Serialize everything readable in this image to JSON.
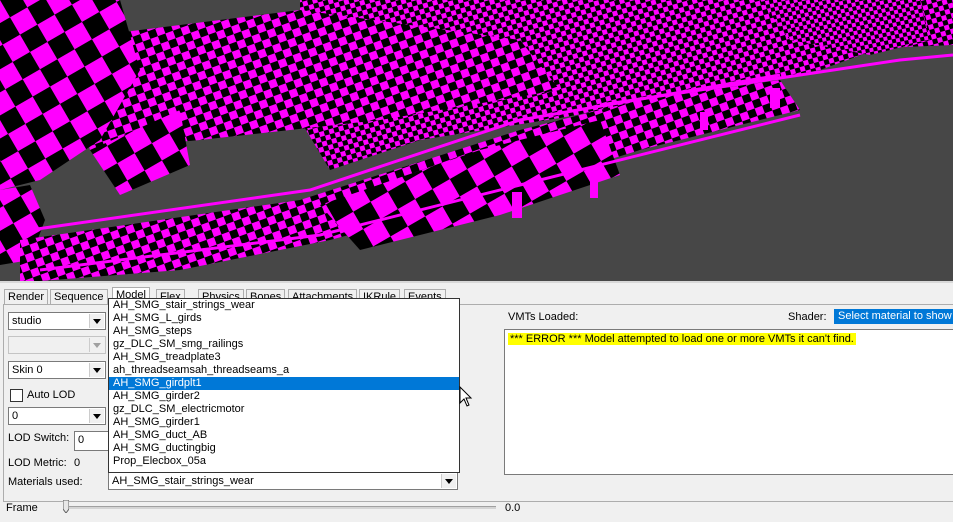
{
  "tabs": [
    {
      "label": "Render"
    },
    {
      "label": "Sequence"
    },
    {
      "label": "Model"
    },
    {
      "label": "Flex"
    },
    {
      "label": "Physics"
    },
    {
      "label": "Bones"
    },
    {
      "label": "Attachments"
    },
    {
      "label": "IKRule"
    },
    {
      "label": "Events"
    }
  ],
  "active_tab": "Model",
  "left": {
    "bodygroup_value": "studio",
    "submodel_value": "",
    "skin_value": "Skin 0",
    "auto_lod_label": "Auto LOD",
    "lod_value": "0",
    "lod_switch_label": "LOD Switch:",
    "lod_switch_value": "0",
    "lod_metric_label": "LOD Metric:",
    "lod_metric_value": "0",
    "materials_label": "Materials used:",
    "materials_value": "AH_SMG_stair_strings_wear"
  },
  "materials_list": [
    "AH_SMG_stair_strings_wear",
    "AH_SMG_L_girds",
    "AH_SMG_steps",
    "gz_DLC_SM_smg_railings",
    "AH_SMG_treadplate3",
    "ah_threadseamsah_threadseams_a",
    "AH_SMG_girdplt1",
    "AH_SMG_girder2",
    "gz_DLC_SM_electricmotor",
    "AH_SMG_girder1",
    "AH_SMG_duct_AB",
    "AH_SMG_ductingbig",
    "Prop_Elecbox_05a"
  ],
  "selected_material_index": 6,
  "vmt": {
    "label": "VMTs Loaded:",
    "error": "*** ERROR *** Model attempted to load one or more VMTs it can't find."
  },
  "shader": {
    "label": "Shader:",
    "value": "Select material to show s"
  },
  "frame": {
    "label": "Frame",
    "value": "0.0"
  },
  "colors": {
    "missing_texture_a": "#ff00ff",
    "missing_texture_b": "#000000",
    "viewport_bg": "#474747",
    "selection": "#0078d7",
    "error_highlight": "#ffff00"
  }
}
